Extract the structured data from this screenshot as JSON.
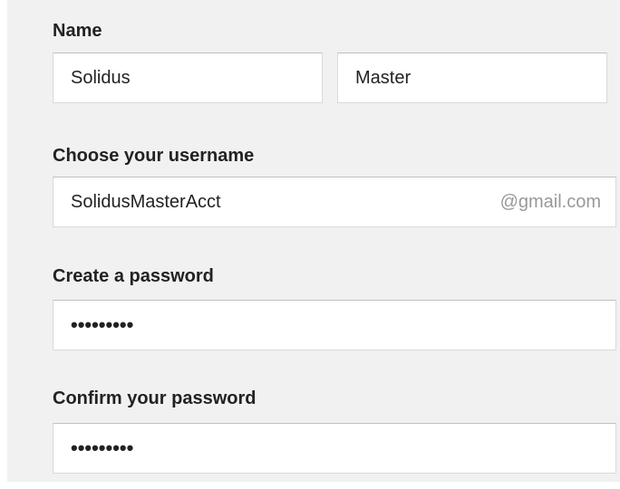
{
  "form": {
    "name": {
      "label": "Name",
      "first_value": "Solidus",
      "last_value": "Master"
    },
    "username": {
      "label": "Choose your username",
      "value": "SolidusMasterAcct",
      "suffix": "@gmail.com"
    },
    "password": {
      "label": "Create a password",
      "masked_value": "•••••••••"
    },
    "confirm_password": {
      "label": "Confirm your password",
      "masked_value": "•••••••••"
    }
  }
}
